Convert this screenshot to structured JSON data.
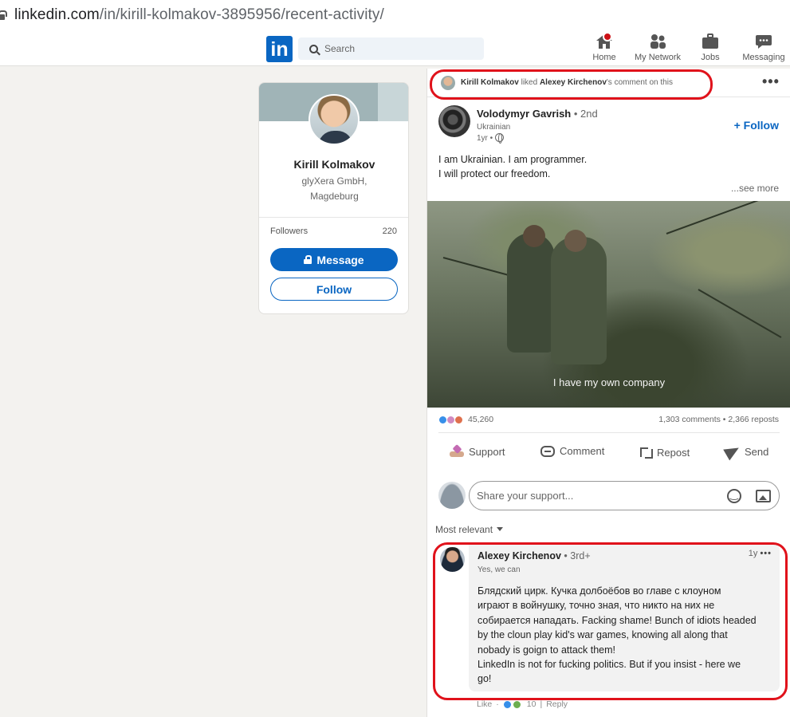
{
  "browser": {
    "url_domain": "linkedin.com",
    "url_path": "/in/kirill-kolmakov-3895956/recent-activity/"
  },
  "nav": {
    "logo": "in",
    "search_placeholder": "Search",
    "items": [
      {
        "label": "Home",
        "icon": "home-icon"
      },
      {
        "label": "My Network",
        "icon": "network-icon"
      },
      {
        "label": "Jobs",
        "icon": "briefcase-icon"
      },
      {
        "label": "Messaging",
        "icon": "chat-icon"
      }
    ]
  },
  "profile": {
    "name": "Kirill Kolmakov",
    "company": "glyXera GmbH,",
    "location": "Magdeburg",
    "followers_label": "Followers",
    "followers_count": "220",
    "message_label": "Message",
    "follow_label": "Follow"
  },
  "activity": {
    "actor": "Kirill Kolmakov",
    "verb": "liked",
    "target": "Alexey Kirchenov",
    "suffix": "'s comment on this"
  },
  "post": {
    "author": "Volodymyr Gavrish",
    "degree": "• 2nd",
    "headline": "Ukrainian",
    "time": "1yr •",
    "follow_label": "+ Follow",
    "text_line1": "I am Ukrainian. I am programmer.",
    "text_line2": "I will protect our freedom.",
    "see_more": "...see more",
    "video_caption": "I have my own company",
    "reactions_count": "45,260",
    "comments_reposts": "1,303 comments • 2,366 reposts",
    "actions": {
      "support": "Support",
      "comment": "Comment",
      "repost": "Repost",
      "send": "Send"
    },
    "share_placeholder": "Share your support...",
    "sort_label": "Most relevant"
  },
  "comment": {
    "author": "Alexey Kirchenov",
    "degree": "• 3rd+",
    "headline": "Yes, we can",
    "time": "1y",
    "lines": [
      "Блядский цирк. Кучка долбоёбов во главе с клоуном",
      "играют в войнушку, точно зная, что никто на них не",
      "собирается нападать. Facking shame! Bunch of idiots headed",
      "by the cloun play kid's war games, knowing all along that",
      "nobady is goign to attack them!",
      "LinkedIn is not for fucking politics. But if you insist - here we",
      "go!"
    ],
    "like_label": "Like",
    "reaction_count": "10",
    "reply_label": "Reply"
  },
  "colors": {
    "brand": "#0a66c2",
    "highlight": "#e0121b",
    "badge": "#cc1016"
  }
}
